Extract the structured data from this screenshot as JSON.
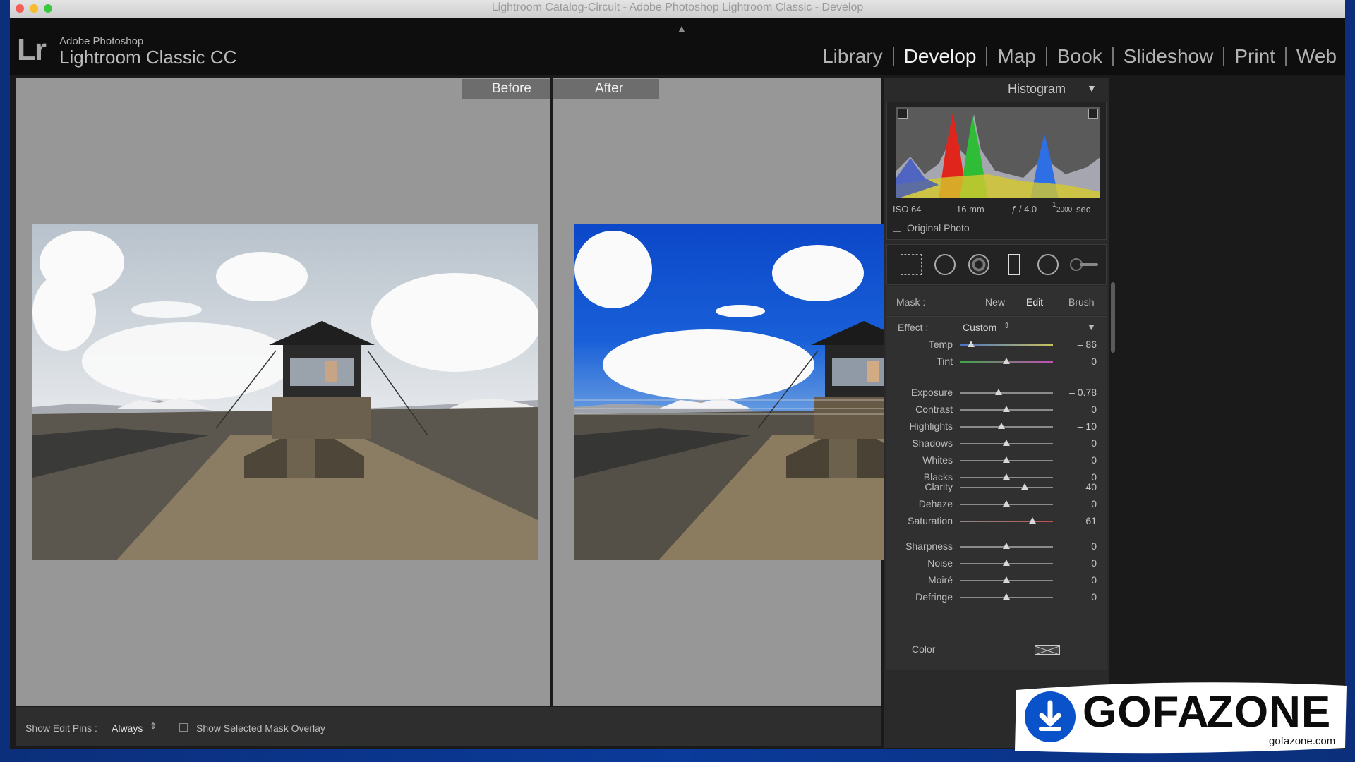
{
  "window": {
    "title": "Lightroom Catalog-Circuit - Adobe Photoshop Lightroom Classic - Develop"
  },
  "app": {
    "logo": "Lr",
    "vendor": "Adobe Photoshop",
    "name": "Lightroom Classic CC"
  },
  "modules": [
    {
      "label": "Library",
      "active": false
    },
    {
      "label": "Develop",
      "active": true
    },
    {
      "label": "Map",
      "active": false
    },
    {
      "label": "Book",
      "active": false
    },
    {
      "label": "Slideshow",
      "active": false
    },
    {
      "label": "Print",
      "active": false
    },
    {
      "label": "Web",
      "active": false
    }
  ],
  "compare": {
    "before_label": "Before",
    "after_label": "After"
  },
  "toolbar": {
    "edit_pins_label": "Show Edit Pins :",
    "edit_pins_value": "Always",
    "mask_overlay_label": "Show Selected Mask Overlay"
  },
  "histogram": {
    "title": "Histogram",
    "iso": "ISO 64",
    "focal": "16 mm",
    "aperture": "ƒ / 4.0",
    "shutter_num": "1",
    "shutter_den": "2000",
    "shutter_unit": "sec",
    "original_photo_label": "Original Photo"
  },
  "mask": {
    "label": "Mask :",
    "new": "New",
    "edit": "Edit",
    "brush": "Brush"
  },
  "effect": {
    "label": "Effect :",
    "value": "Custom"
  },
  "sliders": [
    {
      "label": "Temp",
      "value": "– 86",
      "pos": 0.12,
      "group": 0
    },
    {
      "label": "Tint",
      "value": "0",
      "pos": 0.5,
      "group": 0
    },
    {
      "label": "Exposure",
      "value": "– 0.78",
      "pos": 0.42,
      "group": 1
    },
    {
      "label": "Contrast",
      "value": "0",
      "pos": 0.5,
      "group": 1
    },
    {
      "label": "Highlights",
      "value": "– 10",
      "pos": 0.45,
      "group": 1
    },
    {
      "label": "Shadows",
      "value": "0",
      "pos": 0.5,
      "group": 1
    },
    {
      "label": "Whites",
      "value": "0",
      "pos": 0.5,
      "group": 1
    },
    {
      "label": "Blacks",
      "value": "0",
      "pos": 0.5,
      "group": 1
    },
    {
      "label": "Clarity",
      "value": "40",
      "pos": 0.7,
      "group": 2
    },
    {
      "label": "Dehaze",
      "value": "0",
      "pos": 0.5,
      "group": 2
    },
    {
      "label": "Saturation",
      "value": "61",
      "pos": 0.78,
      "group": 2
    },
    {
      "label": "Sharpness",
      "value": "0",
      "pos": 0.5,
      "group": 3
    },
    {
      "label": "Noise",
      "value": "0",
      "pos": 0.5,
      "group": 3
    },
    {
      "label": "Moiré",
      "value": "0",
      "pos": 0.5,
      "group": 3
    },
    {
      "label": "Defringe",
      "value": "0",
      "pos": 0.5,
      "group": 3
    }
  ],
  "color": {
    "label": "Color"
  },
  "watermark": {
    "brand_a": "GOFA",
    "brand_b": "ZONE",
    "domain": "gofazone.com",
    "accent": "#0a52c9"
  }
}
